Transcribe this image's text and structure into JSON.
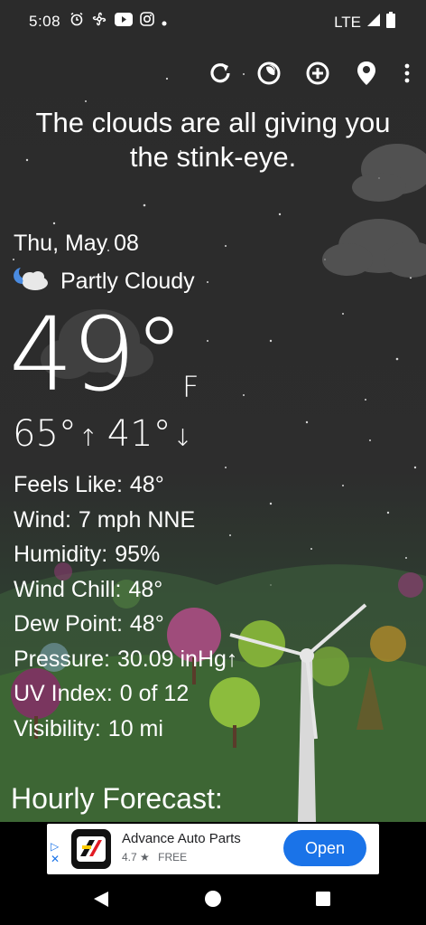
{
  "status_bar": {
    "time": "5:08",
    "network": "LTE",
    "icons": [
      "alarm-icon",
      "fan-icon",
      "youtube-icon",
      "instagram-icon",
      "dot-icon"
    ]
  },
  "toolbar": {
    "buttons": [
      "refresh-icon",
      "theme-icon",
      "add-location-icon",
      "location-pin-icon",
      "more-options-icon"
    ]
  },
  "weather": {
    "quote": "The clouds are all giving you the stink-eye.",
    "date": "Thu, May 08",
    "condition": "Partly Cloudy",
    "temperature": "49°",
    "unit": "F",
    "high": "65°",
    "low": "41°",
    "details": [
      {
        "label": "Feels Like:",
        "value": "48°"
      },
      {
        "label": "Wind:",
        "value": "7 mph NNE"
      },
      {
        "label": "Humidity:",
        "value": "95%"
      },
      {
        "label": "Wind Chill:",
        "value": "48°"
      },
      {
        "label": "Dew Point:",
        "value": "48°"
      },
      {
        "label": "Pressure:",
        "value": "30.09 inHg↑"
      },
      {
        "label": "UV Index:",
        "value": "0 of 12"
      },
      {
        "label": "Visibility:",
        "value": "10 mi"
      }
    ],
    "hourly_title": "Hourly Forecast:"
  },
  "ad": {
    "title": "Advance Auto Parts",
    "rating": "4.7 ★",
    "price": "FREE",
    "button": "Open"
  },
  "colors": {
    "background": "#2b2b2b",
    "ad_button": "#1a73e8"
  }
}
